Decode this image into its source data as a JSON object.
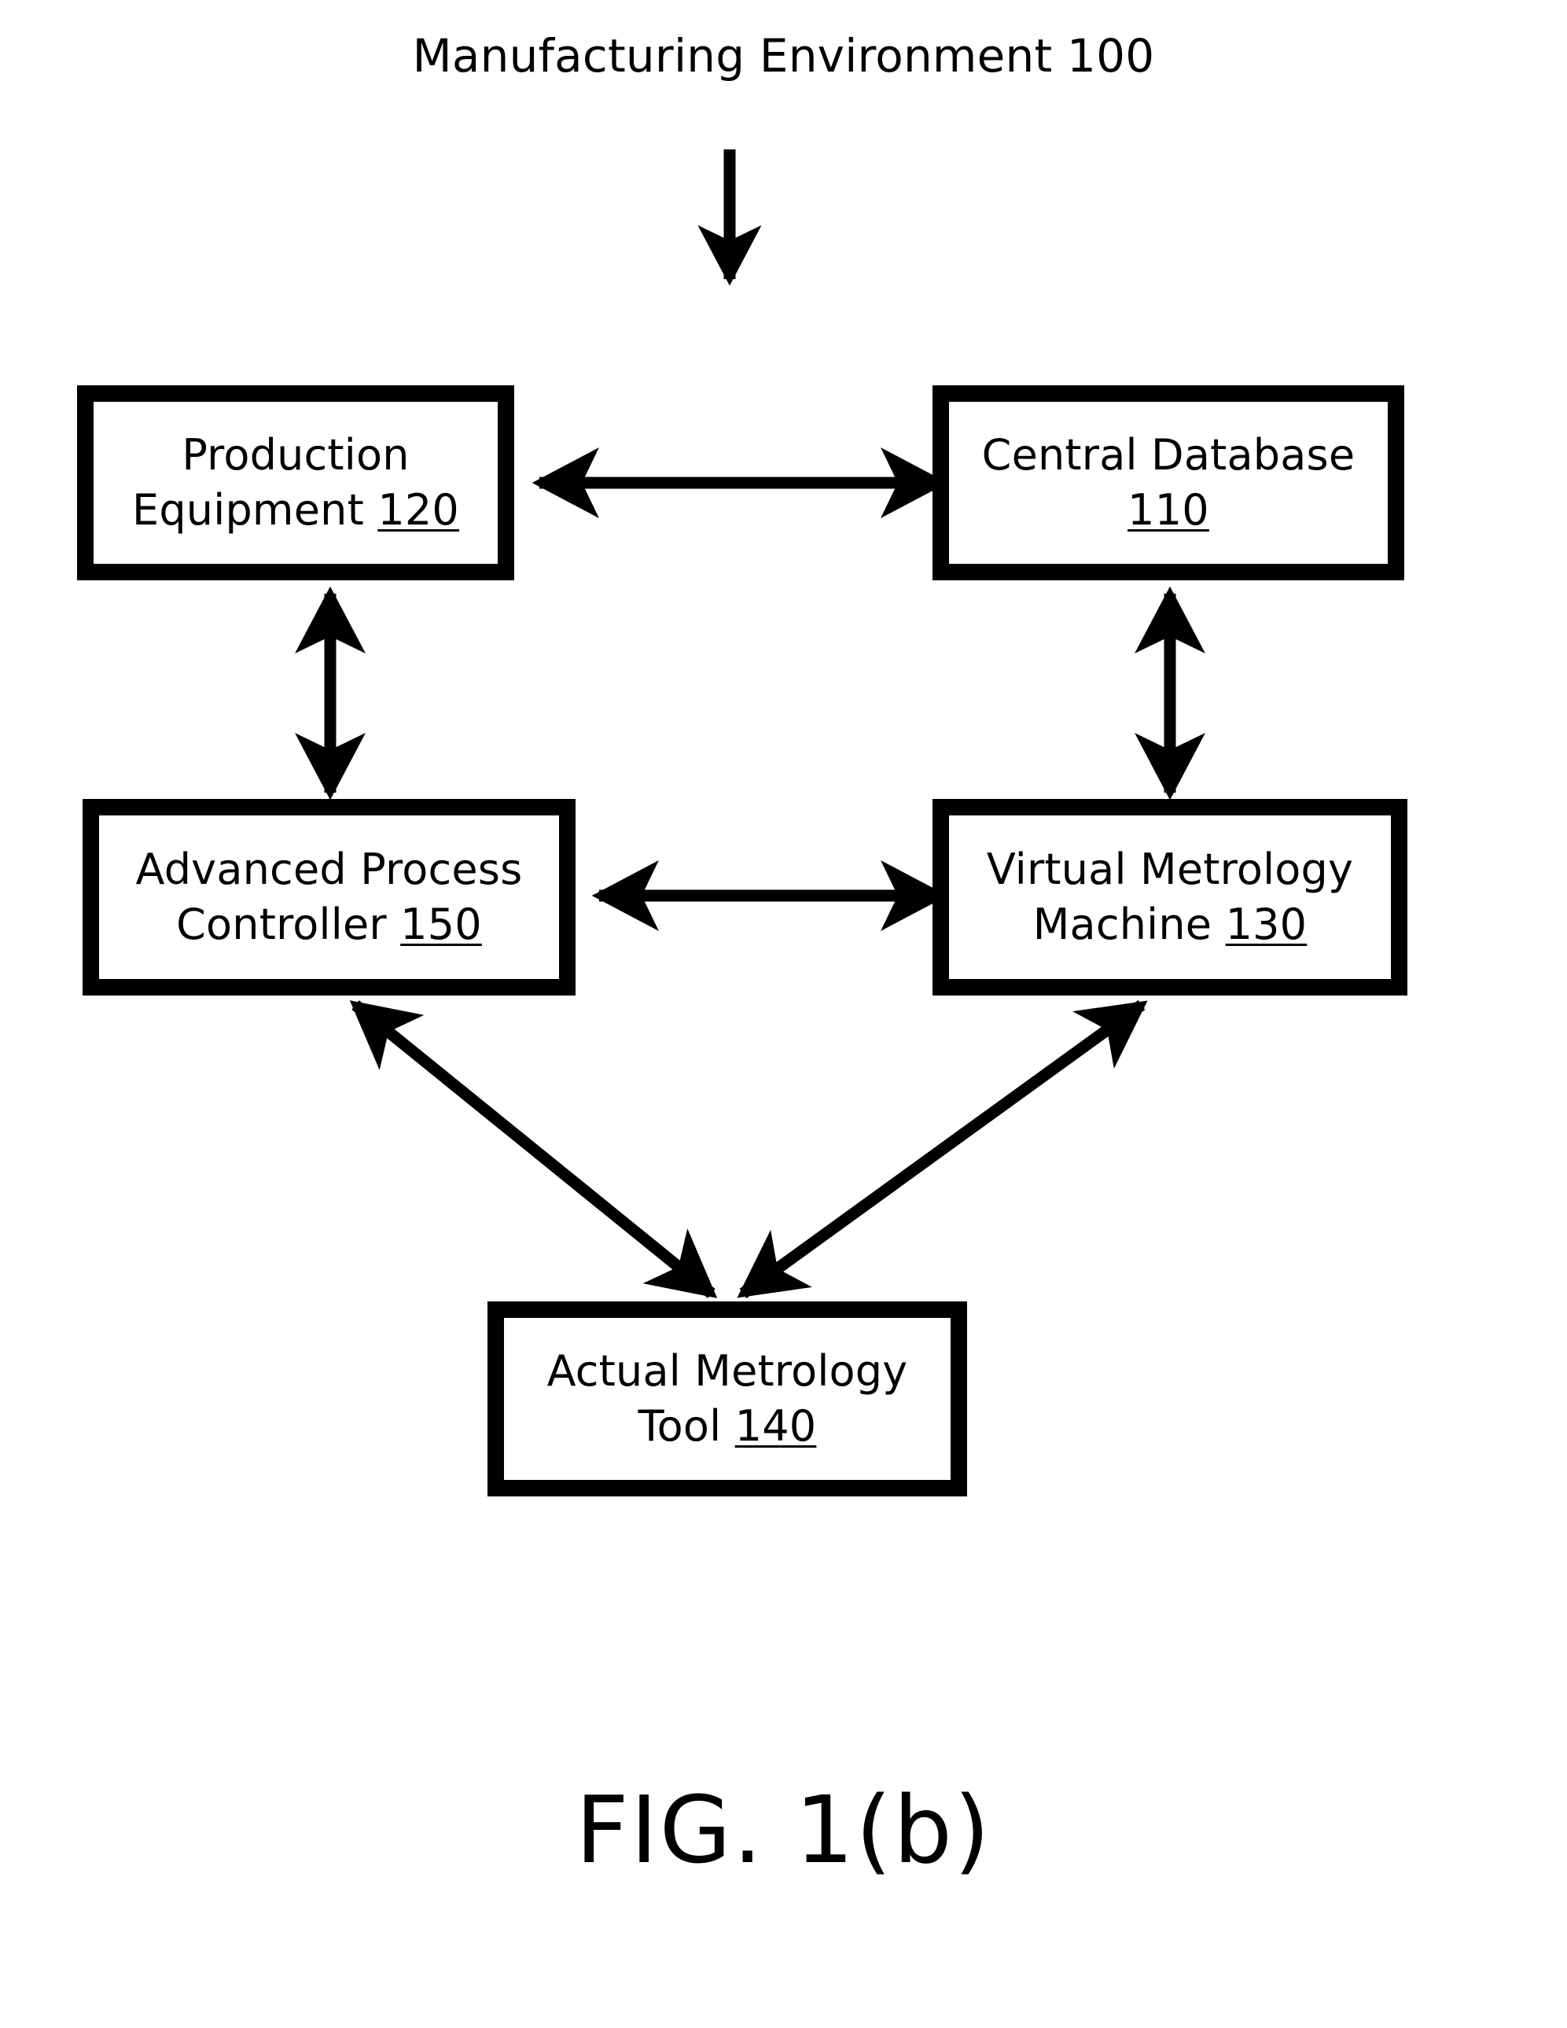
{
  "figure": {
    "caption": "FIG. 1(b)",
    "environment_title": "Manufacturing Environment 100",
    "environment_ref": "100"
  },
  "nodes": [
    {
      "id": "production-equipment",
      "line1": "Production",
      "line2_text": "Equipment ",
      "ref": "120"
    },
    {
      "id": "central-database",
      "line1": "Central Database",
      "line2_text": "",
      "ref": "110"
    },
    {
      "id": "advanced-process-controller",
      "line1": "Advanced Process",
      "line2_text": "Controller ",
      "ref": "150"
    },
    {
      "id": "virtual-metrology-machine",
      "line1": "Virtual Metrology",
      "line2_text": "Machine ",
      "ref": "130"
    },
    {
      "id": "actual-metrology-tool",
      "line1": "Actual Metrology",
      "line2_text": "Tool ",
      "ref": "140"
    }
  ],
  "connectors": [
    {
      "id": "title-to-diagram",
      "from": "Manufacturing Environment 100",
      "to": "diagram",
      "heads": "single",
      "direction": "down"
    },
    {
      "id": "production-equipment-to-central-database",
      "from": "Production Equipment 120",
      "to": "Central Database 110",
      "heads": "double",
      "direction": "horizontal"
    },
    {
      "id": "production-equipment-to-advanced-process-controller",
      "from": "Production Equipment 120",
      "to": "Advanced Process Controller 150",
      "heads": "double",
      "direction": "vertical"
    },
    {
      "id": "central-database-to-virtual-metrology-machine",
      "from": "Central Database 110",
      "to": "Virtual Metrology Machine 130",
      "heads": "double",
      "direction": "vertical"
    },
    {
      "id": "advanced-process-controller-to-virtual-metrology-machine",
      "from": "Advanced Process Controller 150",
      "to": "Virtual Metrology Machine 130",
      "heads": "double",
      "direction": "horizontal"
    },
    {
      "id": "advanced-process-controller-to-actual-metrology-tool",
      "from": "Advanced Process Controller 150",
      "to": "Actual Metrology Tool 140",
      "heads": "double",
      "direction": "diagonal"
    },
    {
      "id": "virtual-metrology-machine-to-actual-metrology-tool",
      "from": "Virtual Metrology Machine 130",
      "to": "Actual Metrology Tool 140",
      "heads": "double",
      "direction": "diagonal"
    }
  ],
  "colors": {
    "ink": "#000000",
    "paper": "#ffffff"
  }
}
